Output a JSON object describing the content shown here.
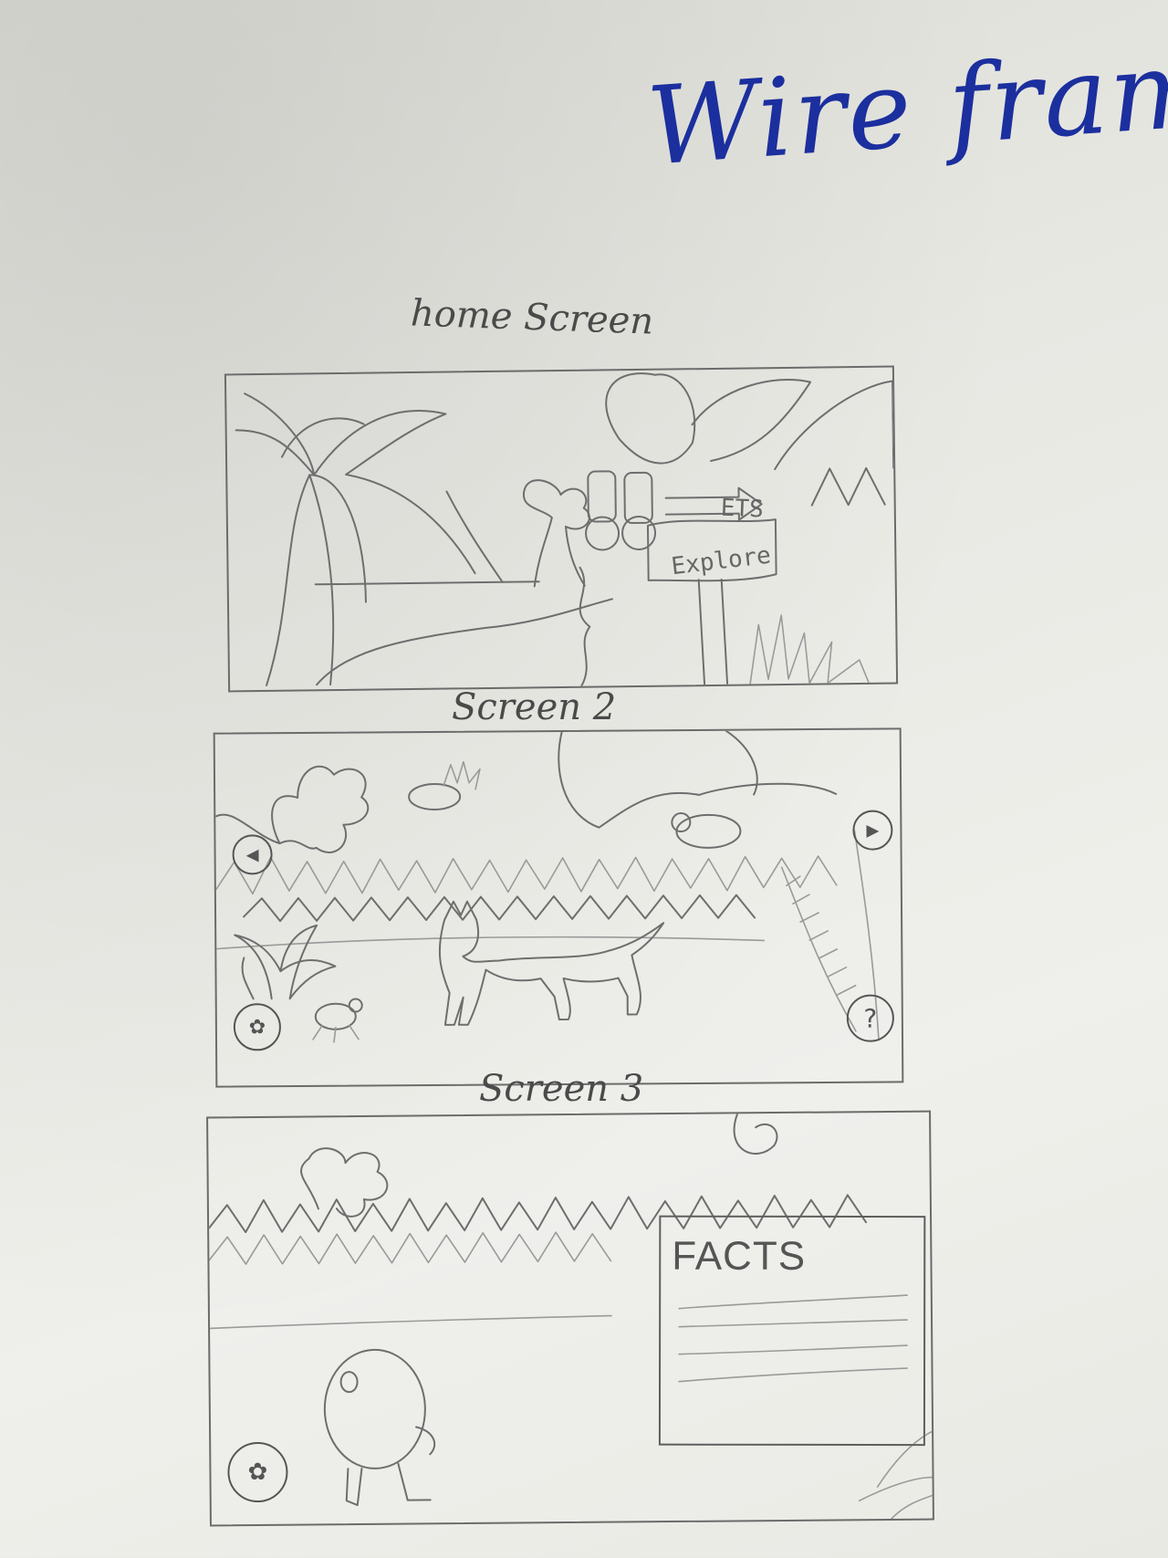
{
  "title": "Wire frame",
  "screens": [
    {
      "label": "home Screen",
      "sign": {
        "top_text": "ETS",
        "bottom_text": "Explore"
      }
    },
    {
      "label": "Screen 2",
      "buttons": {
        "prev_icon": "◀",
        "next_icon": "▶",
        "paw_icon": "✿",
        "help_icon": "?"
      }
    },
    {
      "label": "Screen 3",
      "facts_title": "FACTS",
      "buttons": {
        "paw_icon": "✿"
      }
    }
  ]
}
